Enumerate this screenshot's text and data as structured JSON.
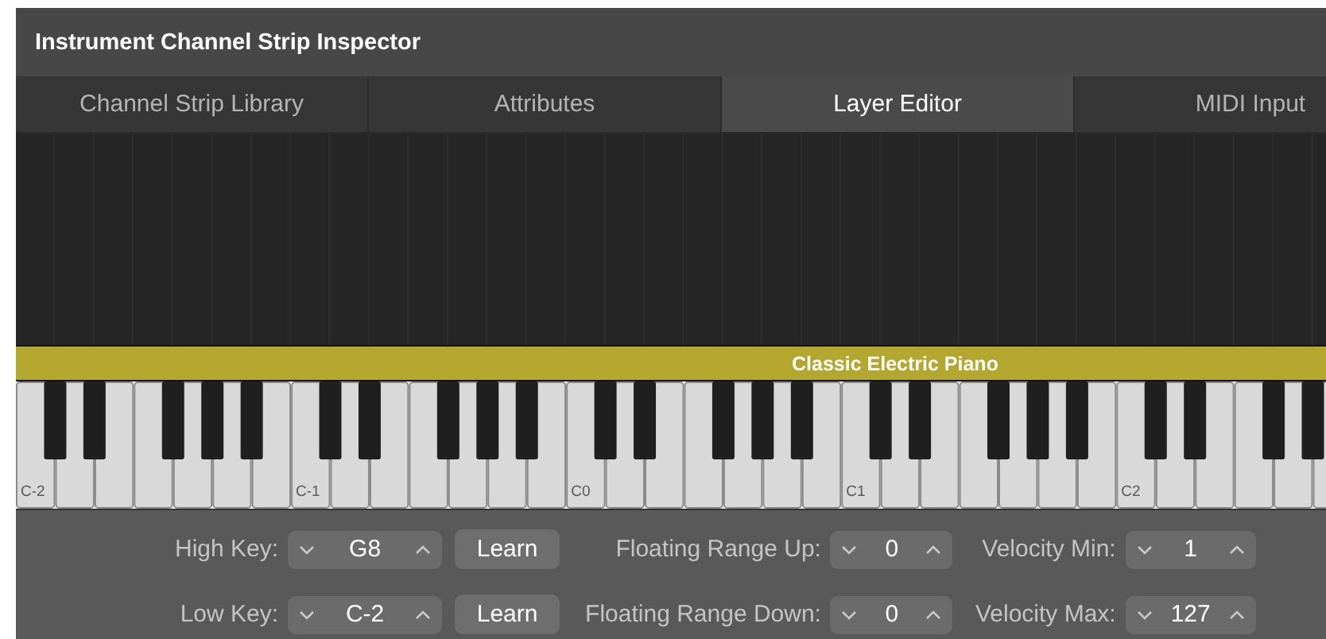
{
  "window": {
    "title": "Instrument Channel Strip Inspector"
  },
  "tabs": [
    {
      "label": "Channel Strip Library",
      "selected": false
    },
    {
      "label": "Attributes",
      "selected": false
    },
    {
      "label": "Layer Editor",
      "selected": true
    },
    {
      "label": "MIDI Input",
      "selected": false
    }
  ],
  "layer": {
    "name": "Classic Electric Piano"
  },
  "keyboard": {
    "octave_labels": [
      "C-2",
      "C-1",
      "C0",
      "C1",
      "C2"
    ]
  },
  "controls": [
    [
      {
        "label": "High Key:",
        "value": "G8",
        "button": "Learn"
      },
      {
        "label": "Floating Range Up:",
        "value": "0"
      },
      {
        "label": "Velocity Min:",
        "value": "1"
      }
    ],
    [
      {
        "label": "Low Key:",
        "value": "C-2",
        "button": "Learn"
      },
      {
        "label": "Floating Range Down:",
        "value": "0"
      },
      {
        "label": "Velocity Max:",
        "value": "127"
      }
    ]
  ]
}
